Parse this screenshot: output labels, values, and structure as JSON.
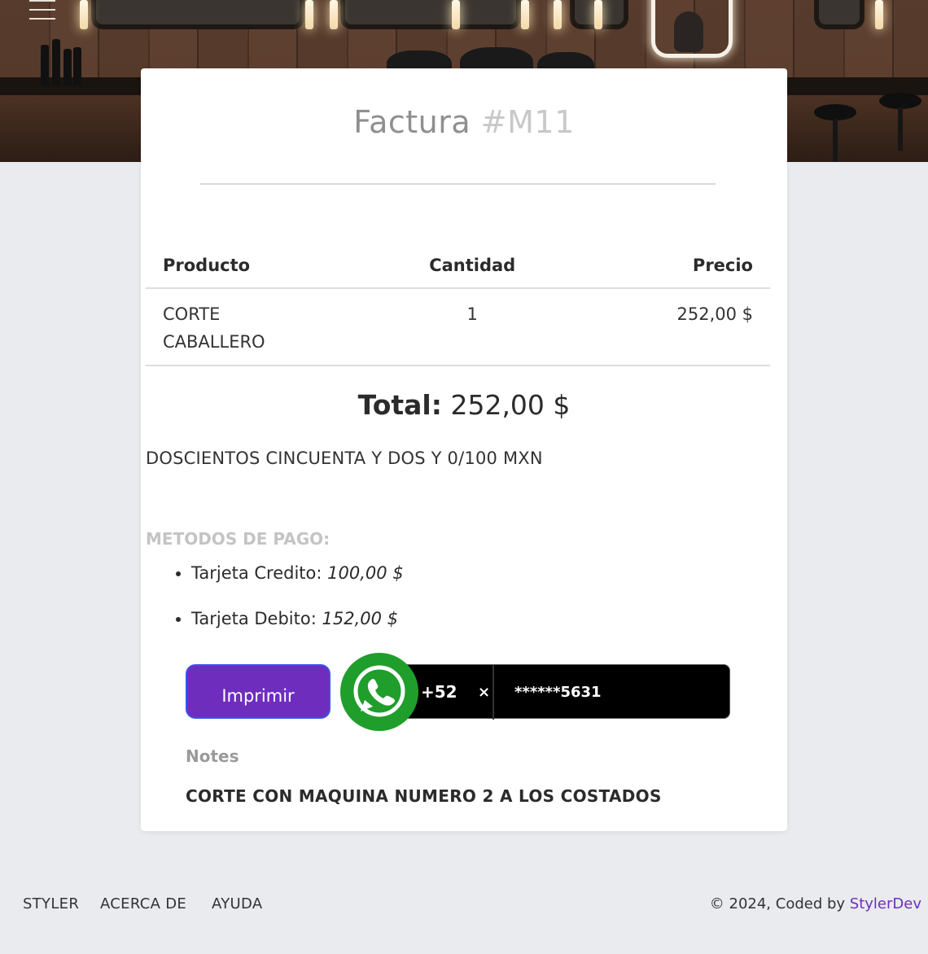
{
  "invoice": {
    "title_prefix": "Factura",
    "number": "#M11"
  },
  "table": {
    "headers": [
      "Producto",
      "Cantidad",
      "Precio"
    ],
    "rows": [
      {
        "product_line1": "CORTE",
        "product_line2": "CABALLERO",
        "quantity": "1",
        "price": "252,00 $"
      }
    ]
  },
  "total": {
    "label": "Total:",
    "value": "252,00 $",
    "in_words": "DOSCIENTOS CINCUENTA Y DOS Y 0/100 MXN"
  },
  "payment": {
    "title": "METODOS DE PAGO:",
    "methods": [
      {
        "label": "Tarjeta Credito:",
        "amount": "100,00 $"
      },
      {
        "label": "Tarjeta Debito:",
        "amount": "152,00 $"
      }
    ]
  },
  "actions": {
    "print_label": "Imprimir",
    "country_code": "+52",
    "clear_symbol": "×",
    "phone": "******5631"
  },
  "notes": {
    "label": "Notes",
    "text": "CORTE CON MAQUINA NUMERO 2 A LOS COSTADOS"
  },
  "footer": {
    "links": [
      "STYLER",
      "ACERCA DE",
      "AYUDA"
    ],
    "copyright_prefix": "© 2024, Coded by",
    "copyright_brand": "StylerDev"
  },
  "colors": {
    "accent": "#6f2dbd",
    "whatsapp": "#1f9e2c",
    "page_bg": "#e9ebef"
  },
  "icons": {
    "menu": "hamburger-menu-icon",
    "whatsapp": "whatsapp-icon"
  }
}
